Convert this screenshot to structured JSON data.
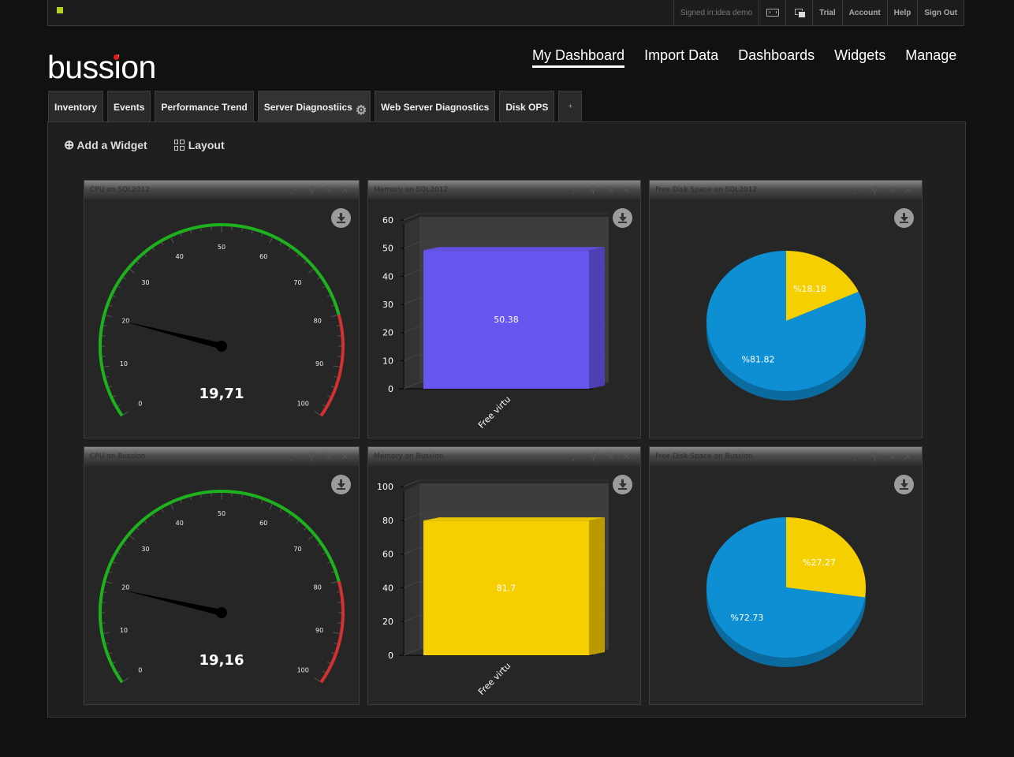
{
  "topbar": {
    "signed_in": "Signed in:idea demo",
    "fullscreen_icon": "fullscreen-icon",
    "window_icon": "window-icon",
    "links": [
      "Trial",
      "Account",
      "Help",
      "Sign Out"
    ]
  },
  "brand": {
    "logo": "bussion",
    "dot_color": "#e01a1a"
  },
  "nav": {
    "items": [
      {
        "label": "My Dashboard",
        "active": true
      },
      {
        "label": "Import Data"
      },
      {
        "label": "Dashboards"
      },
      {
        "label": "Widgets"
      },
      {
        "label": "Manage"
      }
    ]
  },
  "tabs": {
    "items": [
      "Inventory",
      "Events",
      "Performance Trend",
      "Server Diagnostiics",
      "Web Server Diagnostics",
      "Disk OPS"
    ],
    "active_index": 3,
    "add_label": "+"
  },
  "toolbar": {
    "add_widget": "Add a Widget",
    "layout": "Layout"
  },
  "colors": {
    "gauge_green": "#1db21d",
    "gauge_red": "#d33030",
    "bar_sql": "#6655ee",
    "bar_bussion": "#f6cf00",
    "pie_blue": "#0e8fd4",
    "pie_yellow": "#f6cf00"
  },
  "widgets": {
    "cpu_sql": {
      "title": "CPU on SQL2012",
      "value_text": "19,71"
    },
    "mem_sql": {
      "title": "Memory on SQL2012"
    },
    "disk_sql": {
      "title": "Free Disk Space on SQL2012"
    },
    "cpu_bus": {
      "title": "CPU on Bussion",
      "value_text": "19,16"
    },
    "mem_bus": {
      "title": "Memory on Bussion"
    },
    "disk_bus": {
      "title": "Free Disk Space on Bussion"
    }
  },
  "chart_data": [
    {
      "type": "gauge",
      "title": "CPU on SQL2012",
      "value": 19.71,
      "value_label": "19,71",
      "range": [
        0,
        100
      ],
      "ticks": [
        0,
        10,
        20,
        30,
        40,
        50,
        60,
        70,
        80,
        90,
        100
      ],
      "bands": [
        {
          "from": 0,
          "to": 80,
          "color": "green"
        },
        {
          "from": 80,
          "to": 100,
          "color": "red"
        }
      ]
    },
    {
      "type": "bar",
      "title": "Memory on SQL2012",
      "categories": [
        "Free virtu"
      ],
      "values": [
        50.38
      ],
      "data_labels": [
        "50.38"
      ],
      "ylim": [
        0,
        60
      ],
      "yticks": [
        0,
        10,
        20,
        30,
        40,
        50,
        60
      ]
    },
    {
      "type": "pie",
      "title": "Free Disk Space on SQL2012",
      "slices": [
        {
          "value": 18.18,
          "label": "%18.18",
          "color": "yellow"
        },
        {
          "value": 81.82,
          "label": "%81.82",
          "color": "blue"
        }
      ]
    },
    {
      "type": "gauge",
      "title": "CPU on Bussion",
      "value": 19.16,
      "value_label": "19,16",
      "range": [
        0,
        100
      ],
      "ticks": [
        0,
        10,
        20,
        30,
        40,
        50,
        60,
        70,
        80,
        90,
        100
      ],
      "bands": [
        {
          "from": 0,
          "to": 80,
          "color": "green"
        },
        {
          "from": 80,
          "to": 100,
          "color": "red"
        }
      ]
    },
    {
      "type": "bar",
      "title": "Memory on Bussion",
      "categories": [
        "Free virtu"
      ],
      "values": [
        81.7
      ],
      "data_labels": [
        "81.7"
      ],
      "ylim": [
        0,
        100
      ],
      "yticks": [
        0,
        20,
        40,
        60,
        80,
        100
      ]
    },
    {
      "type": "pie",
      "title": "Free Disk Space on Bussion",
      "slices": [
        {
          "value": 27.27,
          "label": "%27.27",
          "color": "yellow"
        },
        {
          "value": 72.73,
          "label": "%72.73",
          "color": "blue"
        }
      ]
    }
  ]
}
